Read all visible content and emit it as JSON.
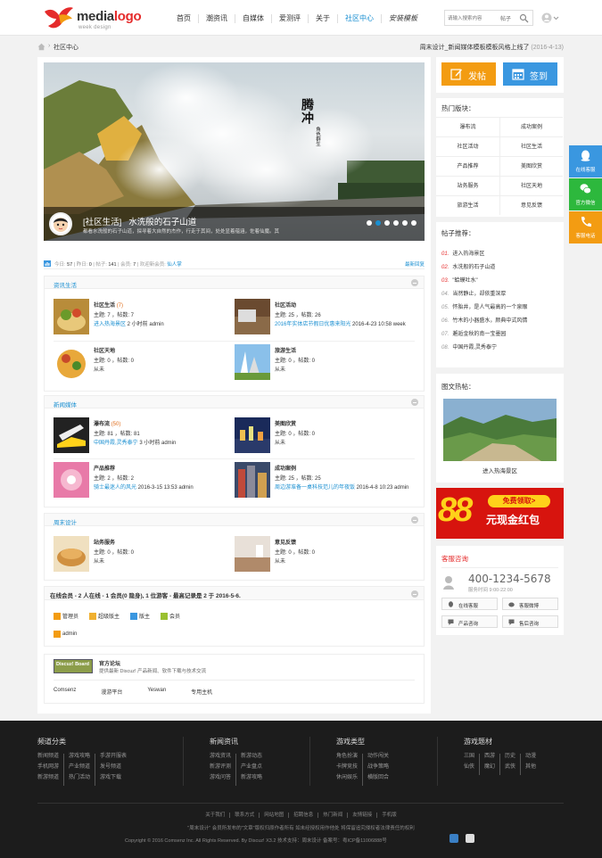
{
  "header": {
    "logo_main": "media",
    "logo_accent": "logo",
    "logo_sub": "week design",
    "nav": [
      "首页",
      "潮资讯",
      "自媒体",
      "爱测评",
      "关于",
      "社区中心",
      "安装模板"
    ],
    "nav_active_index": 5,
    "search_placeholder": "请输入搜索内容",
    "search_type": "帖子"
  },
  "breadcrumb": {
    "current": "社区中心",
    "notice": "周末设计_新闻媒体模板模板风格上线了",
    "notice_date": "(2016-4-13)"
  },
  "slider": {
    "tag": "[社区生活]",
    "title": "水洗般的石子山道",
    "desc": "都看水洗般的石子山道，探寻着大自然的杰作，行走于其间，处处显着蕴涵，佐着仙魔。其",
    "vertical_text": "腾冲",
    "vertical_sub": "角色群生",
    "dots": 6,
    "active_dot": 1
  },
  "stats": {
    "today_label": "今日:",
    "today": "57",
    "yesterday_label": "昨日:",
    "yesterday": "0",
    "posts_label": "帖子:",
    "posts": "141",
    "members_label": "会员:",
    "members": "7",
    "welcome": "欢迎新会员:",
    "new_member": "仙人掌",
    "latest": "最新回复"
  },
  "groups": [
    {
      "title": "资讯生活",
      "forums": [
        {
          "name": "社区生活",
          "count": "(7)",
          "stats": "主题: 7 ，帖数: 7",
          "last_link": "进入热海景区",
          "last_rest": " 2 小时前 admin",
          "thumb": "food1"
        },
        {
          "name": "社区活动",
          "count": "",
          "stats": "主题: 25 ，帖数: 26",
          "last_link": "2016年实体店节假日优惠来阳光",
          "last_rest": " 2016-4-23 10:58 week",
          "thumb": "wood"
        },
        {
          "name": "社区天地",
          "count": "",
          "stats": "主题: 0 ，帖数: 0",
          "last_link": "",
          "last_rest": "从未",
          "thumb": "food2"
        },
        {
          "name": "旅游生活",
          "count": "",
          "stats": "主题: 0 ，帖数: 0",
          "last_link": "",
          "last_rest": "从未",
          "thumb": "building"
        }
      ]
    },
    {
      "title": "新闻媒体",
      "forums": [
        {
          "name": "瀑布流",
          "count": "(50)",
          "stats": "主题: 81 ，帖数: 81",
          "last_link": "中国丹霞,灵秀泰宁",
          "last_rest": " 3 小时前 admin",
          "thumb": "shoe"
        },
        {
          "name": "美图欣赏",
          "count": "",
          "stats": "主题: 0 ，帖数: 0",
          "last_link": "",
          "last_rest": "从未",
          "thumb": "city"
        },
        {
          "name": "产品推荐",
          "count": "",
          "stats": "主题: 2 ，帖数: 2",
          "last_link": "骑士最迷人的风光",
          "last_rest": " 2016-3-15 13:53 admin",
          "thumb": "pink"
        },
        {
          "name": "成功案例",
          "count": "",
          "stats": "主题: 25 ，帖数: 25",
          "last_link": "周边游准备一桌科技范儿的年夜饭",
          "last_rest": " 2016-4-8 10:23 admin",
          "thumb": "tower"
        }
      ]
    },
    {
      "title": "周末设计",
      "forums": [
        {
          "name": "站务服务",
          "count": "",
          "stats": "主题: 0 ，帖数: 0",
          "last_link": "",
          "last_rest": "从未",
          "thumb": "bread"
        },
        {
          "name": "意见反馈",
          "count": "",
          "stats": "主题: 0 ，帖数: 0",
          "last_link": "",
          "last_rest": "从未",
          "thumb": "desk"
        }
      ]
    }
  ],
  "online": {
    "title": "在线会员 - 2 人在线 - 1 会员(0 隐身), 1 位游客 - 最高记录是 2 于 2016-5-6.",
    "legend": [
      "管理员",
      "超级版主",
      "版主",
      "会员"
    ],
    "user": "admin"
  },
  "links": {
    "badge": "Discuz! Board",
    "title": "官方论坛",
    "desc": "提供最新 Discuz! 产品新闻、软件下载与技术交流",
    "items": [
      "Comsenz",
      "漫游平台",
      "Yeswan",
      "专用主机"
    ]
  },
  "sidebar": {
    "post_btn": "发帖",
    "sign_btn": "签到",
    "hot_title": "热门版块：",
    "hot": [
      "瀑布流",
      "成功案例",
      "社区活动",
      "社区生活",
      "产品推荐",
      "美图欣赏",
      "站务服务",
      "社区天地",
      "旅游生活",
      "意见反馈"
    ],
    "rec_title": "帖子推荐：",
    "rec": [
      "进入热海景区",
      "水洗般的石子山道",
      "\"蛤蟆吐水\"",
      "当然静止，却依重深厚",
      "怀胎井，是人气最高的一个泉眼",
      "竹木的小器盛水，颜典中式风情",
      "邂逅金秋的南一宝墨园",
      "中国丹霞,灵秀泰宁"
    ],
    "rec_nums": [
      "01.",
      "02.",
      "03.",
      "04.",
      "05.",
      "06.",
      "07.",
      "08."
    ],
    "pic_title": "图文热帖：",
    "pic_caption": "进入热海景区",
    "ad_num": "88",
    "ad_free": "免费领取>",
    "ad_text": "元现金红包",
    "cs_title": "客服咨询",
    "cs_tel": "400-1234-5678",
    "cs_time": "服务时间 9:00-22:00",
    "cs_btns": [
      "在线客服",
      "客服微博",
      "产品咨询",
      "售后咨询"
    ]
  },
  "floatbar": [
    "在线客服",
    "官方微信",
    "客服电话"
  ],
  "footer": {
    "cols": [
      {
        "title": "频道分类",
        "rows": [
          [
            "新闻频道",
            "游戏攻略",
            "手游开服表"
          ],
          [
            "手机网游",
            "产业频道",
            "发号频道"
          ],
          [
            "新游频道",
            "热门活动",
            "游戏下载"
          ]
        ]
      },
      {
        "title": "新闻资讯",
        "rows": [
          [
            "游戏资讯",
            "新游动态"
          ],
          [
            "新游评测",
            "产业盘点"
          ],
          [
            "游戏问答",
            "新游攻略"
          ]
        ]
      },
      {
        "title": "游戏类型",
        "rows": [
          [
            "角色扮演",
            "动作闯关"
          ],
          [
            "卡牌竞技",
            "战争策略"
          ],
          [
            "休闲娱乐",
            "横版回合"
          ]
        ]
      },
      {
        "title": "游戏题材",
        "rows": [
          [
            "三国",
            "西游",
            "历史",
            "动漫"
          ],
          [
            "仙侠",
            "魔幻",
            "武侠",
            "其他"
          ]
        ]
      }
    ],
    "links": [
      "关于我们",
      "联系方式",
      "网站地图",
      "招聘信息",
      "热门新闻",
      "友情链接",
      "手机版"
    ],
    "copy1": "\"周末设计\" 会员所发布的\"文章\"版权归原作者所有 如未经授权用作他处 将保留追究侵权者法律责任的权利",
    "copy2": "Copyright © 2016   Comsenz Inc.   All Rights Reserved.  By   Discuz!   X3.2    技术支持：周末设计     备案号：粤ICP备11006888号"
  },
  "colors": {
    "accent": "#1a8fd1",
    "orange": "#f39c12",
    "blue": "#3a97e0",
    "red": "#e52b2b",
    "green": "#2db83d"
  }
}
